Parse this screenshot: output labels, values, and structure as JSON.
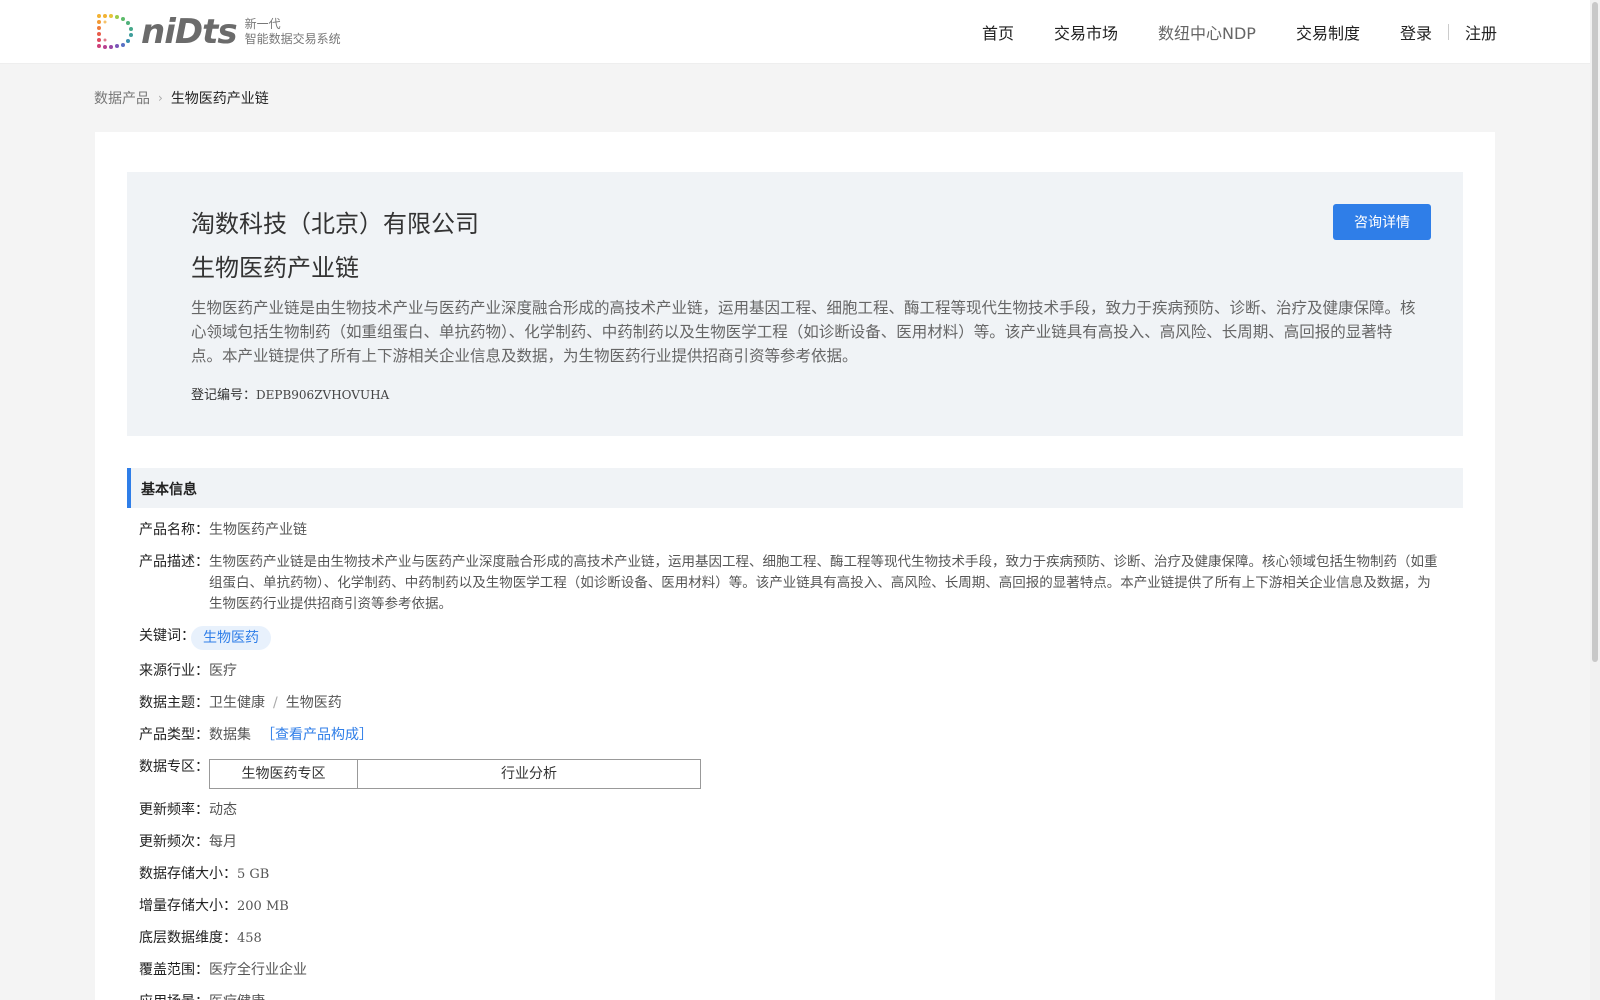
{
  "header": {
    "logo_word": "niDts",
    "logo_tagline_1": "新一代",
    "logo_tagline_2": "智能数据交易系统",
    "nav": [
      "首页",
      "交易市场",
      "数纽中心NDP",
      "交易制度"
    ],
    "login": "登录",
    "register": "注册"
  },
  "breadcrumb": {
    "parent": "数据产品",
    "current": "生物医药产业链"
  },
  "hero": {
    "company": "淘数科技（北京）有限公司",
    "title": "生物医药产业链",
    "description": "生物医药产业链是由生物技术产业与医药产业深度融合形成的高技术产业链，运用基因工程、细胞工程、酶工程等现代生物技术手段，致力于疾病预防、诊断、治疗及健康保障。核心领域包括生物制药（如重组蛋白、单抗药物）、化学制药、中药制药以及生物医学工程（如诊断设备、医用材料）等。该产业链具有高投入、高风险、长周期、高回报的显著特点。本产业链提供了所有上下游相关企业信息及数据，为生物医药行业提供招商引资等参考依据。",
    "reg_label": "登记编号：",
    "reg_code": "DEPB906ZVHOVUHA",
    "consult_button": "咨询详情"
  },
  "section": {
    "title": "基本信息"
  },
  "info": {
    "name_label": "产品名称：",
    "name": "生物医药产业链",
    "desc_label": "产品描述：",
    "desc": "生物医药产业链是由生物技术产业与医药产业深度融合形成的高技术产业链，运用基因工程、细胞工程、酶工程等现代生物技术手段，致力于疾病预防、诊断、治疗及健康保障。核心领域包括生物制药（如重组蛋白、单抗药物）、化学制药、中药制药以及生物医学工程（如诊断设备、医用材料）等。该产业链具有高投入、高风险、长周期、高回报的显著特点。本产业链提供了所有上下游相关企业信息及数据，为生物医药行业提供招商引资等参考依据。",
    "keyword_label": "关键词：",
    "keyword": "生物医药",
    "industry_label": "来源行业：",
    "industry": "医疗",
    "topic_label": "数据主题：",
    "topic_1": "卫生健康",
    "topic_sep": "/",
    "topic_2": "生物医药",
    "type_label": "产品类型：",
    "type": "数据集",
    "type_link": "［查看产品构成］",
    "zone_label": "数据专区：",
    "zone_1": "生物医药专区",
    "zone_2": "行业分析",
    "freq_label": "更新频率：",
    "freq": "动态",
    "freq2_label": "更新频次：",
    "freq2": "每月",
    "storage_label": "数据存储大小：",
    "storage": "5 GB",
    "inc_label": "增量存储大小：",
    "inc": "200 MB",
    "dim_label": "底层数据维度：",
    "dim": "458",
    "coverage_label": "覆盖范围：",
    "coverage": "医疗全行业企业",
    "scene_label": "应用场景：",
    "scene": "医疗健康"
  },
  "colors": {
    "accent": "#2f7ee8",
    "panel": "#f0f3f6",
    "page_bg": "#f4f4f4"
  }
}
